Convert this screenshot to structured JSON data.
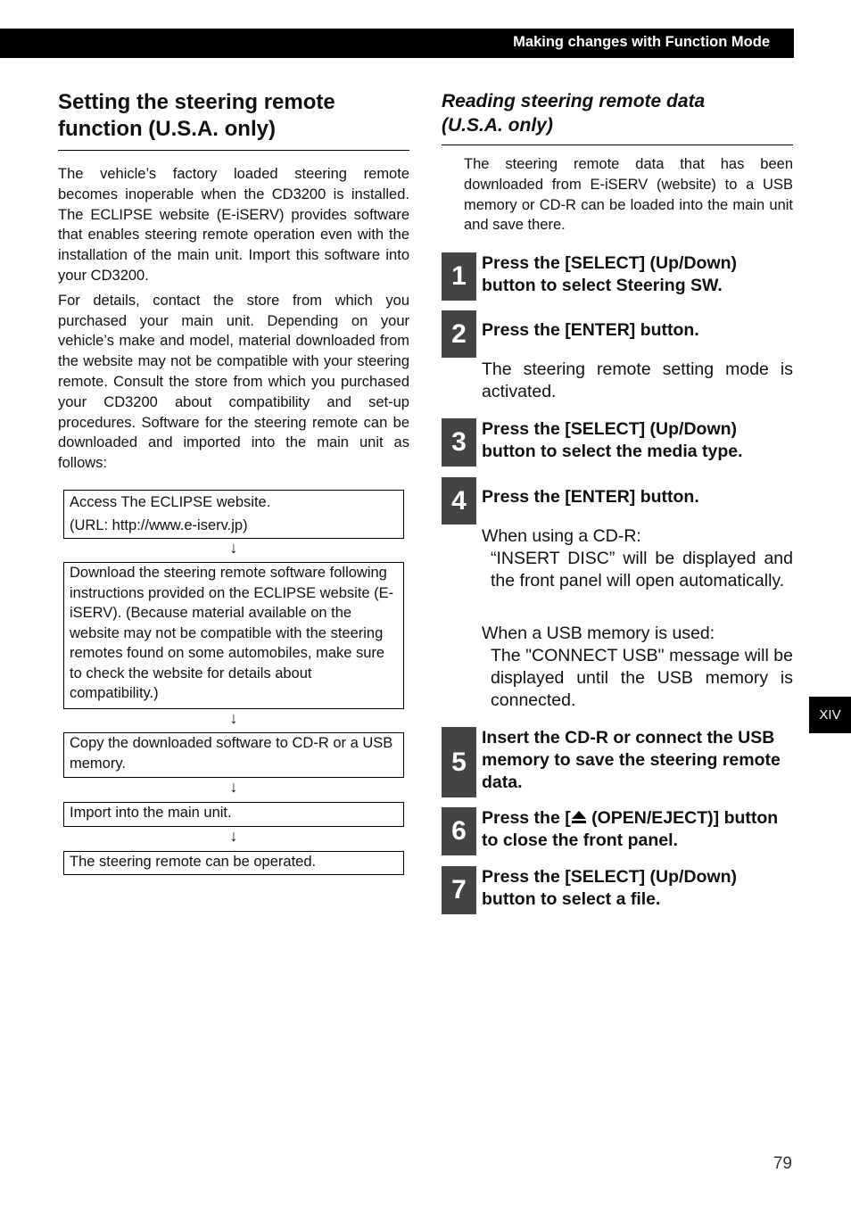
{
  "header": {
    "title": "Making changes with Function Mode"
  },
  "left": {
    "title_line1": "Setting the steering remote",
    "title_line2": "function (U.S.A. only)",
    "paragraphs": [
      "The vehicle’s factory loaded steering remote becomes inoperable when the CD3200 is installed. The ECLIPSE website (E-iSERV) provides software that enables steering remote operation even with the installation of the main unit. Import this software into your CD3200.",
      "For details, contact the store from which you purchased your main unit. Depending on your vehicle’s make and model, material downloaded from the website may not be compatible with your steering remote. Consult the store from which you purchased your CD3200 about compatibility and set-up procedures. Software for the steering remote can be downloaded and imported into the main unit as follows:"
    ],
    "flow": [
      {
        "line1": "Access The ECLIPSE website.",
        "line2": "(URL: http://www.e-iserv.jp)"
      },
      {
        "text": "Download the steering remote software following instructions provided on the ECLIPSE website (E-iSERV). (Because material available on the website may not be compatible with the steering remotes found on some automobiles, make sure to check the website for details about compatibility.)"
      },
      {
        "text": "Copy the downloaded software to CD-R or a USB memory."
      },
      {
        "text": "Import into the main unit."
      },
      {
        "text": "The steering remote can be operated."
      }
    ],
    "arrow": "↓"
  },
  "right": {
    "title_line1": "Reading steering remote data",
    "title_line2": "(U.S.A. only)",
    "intro": "The steering remote data that has been downloaded from E-iSERV (website) to a USB memory or CD-R can be loaded into the main unit and save there.",
    "steps": [
      {
        "num": "1",
        "text": "Press the [SELECT] (Up/Down) button to select Steering SW."
      },
      {
        "num": "2",
        "text": "Press the [ENTER] button."
      },
      {
        "num": "3",
        "text": "Press the [SELECT] (Up/Down) button to select the media type."
      },
      {
        "num": "4",
        "text": "Press the [ENTER] button."
      },
      {
        "num": "5",
        "text": "Insert the CD-R or connect the USB memory to save the steering remote data."
      },
      {
        "num": "6",
        "text_pre": "Press the [",
        "text_post": " (OPEN/EJECT)] button to close the front panel."
      },
      {
        "num": "7",
        "text": "Press the [SELECT] (Up/Down) button to select a file."
      }
    ],
    "step2_note": "The steering remote setting mode is activated.",
    "step4_cd_label": "When using a CD-R:",
    "step4_cd_text": "“INSERT DISC” will be displayed and the front panel will open automatically.",
    "step4_usb_label": "When a USB memory is used:",
    "step4_usb_text": "The \"CONNECT USB\" message will be displayed until the USB memory is connected."
  },
  "side_tab": "XIV",
  "page_number": "79"
}
